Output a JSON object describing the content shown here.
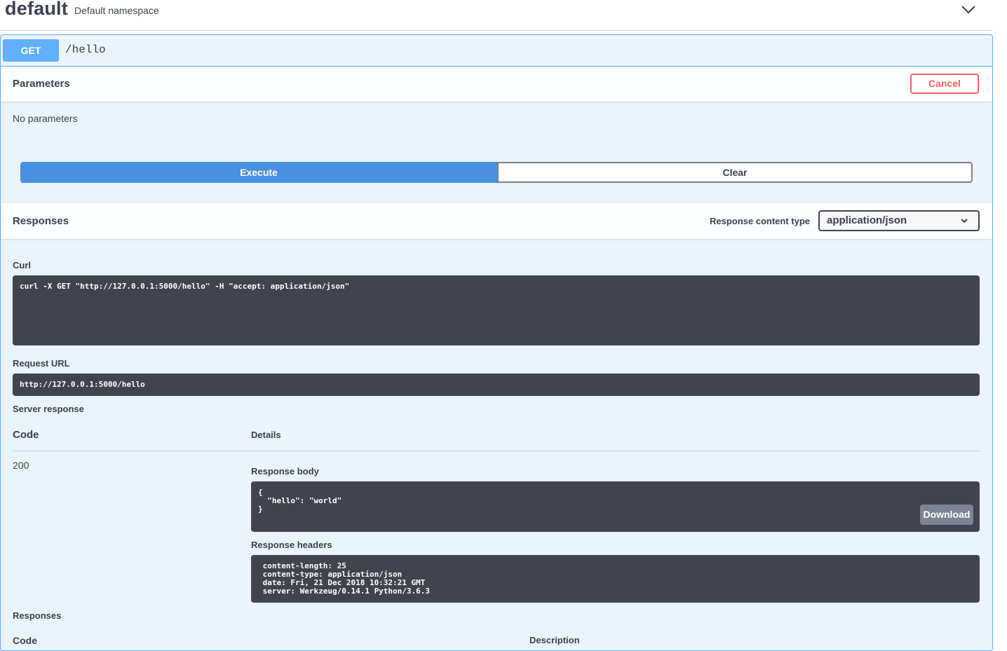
{
  "namespace": {
    "title": "default",
    "description": "Default namespace",
    "toggle_icon": "chevron-down-icon"
  },
  "operation": {
    "method": "GET",
    "path": "/hello"
  },
  "parameters": {
    "title": "Parameters",
    "cancel_label": "Cancel",
    "empty_text": "No parameters"
  },
  "actions": {
    "execute_label": "Execute",
    "clear_label": "Clear"
  },
  "responses_header": {
    "title": "Responses",
    "content_type_label": "Response content type",
    "content_type_value": "application/json"
  },
  "curl": {
    "label": "Curl",
    "command": "curl -X GET \"http://127.0.0.1:5000/hello\" -H \"accept: application/json\""
  },
  "request_url": {
    "label": "Request URL",
    "value": "http://127.0.0.1:5000/hello"
  },
  "server_response": {
    "label": "Server response",
    "code_header": "Code",
    "details_header": "Details",
    "code": "200",
    "body_label": "Response body",
    "body": "{\n  \"hello\": \"world\"\n}",
    "download_label": "Download",
    "headers_label": "Response headers",
    "headers": " content-length: 25 \n content-type: application/json \n date: Fri, 21 Dec 2018 10:32:21 GMT \n server: Werkzeug/0.14.1 Python/3.6.3 "
  },
  "responses_table": {
    "title": "Responses",
    "code_header": "Code",
    "description_header": "Description"
  },
  "colors": {
    "get_accent": "#61affe",
    "execute_blue": "#4990e2",
    "cancel_red": "#ff6060",
    "code_bg": "#41444e"
  }
}
